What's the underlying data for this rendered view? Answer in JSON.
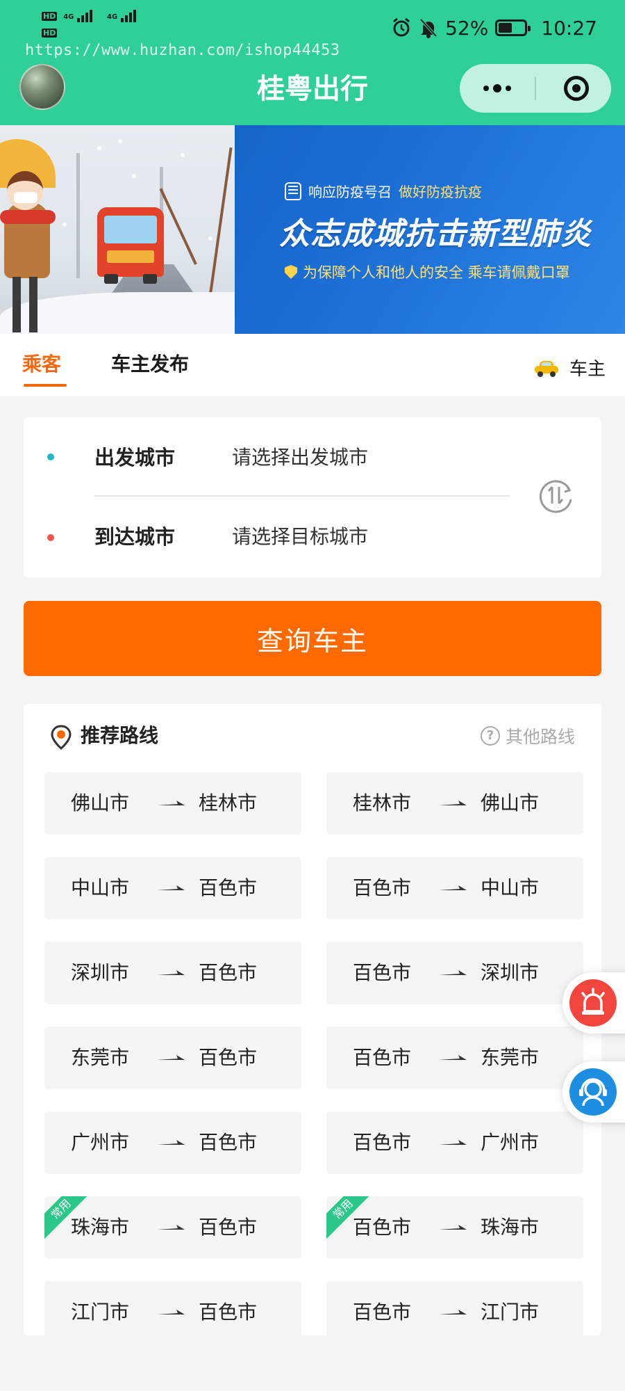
{
  "status_bar": {
    "signal_1": "4G",
    "signal_2": "4G",
    "hd_1": "HD",
    "hd_2": "HD",
    "battery": "52%",
    "battery_level": 0.52,
    "time": "10:27"
  },
  "watermark": "https://www.huzhan.com/ishop44453",
  "header": {
    "title": "桂粤出行"
  },
  "banner": {
    "line1_a": "响应防疫号召",
    "line1_b": "做好防疫抗疫",
    "line2": "众志成城抗击新型肺炎",
    "line3": "为保障个人和他人的安全 乘车请佩戴口罩"
  },
  "tabs": {
    "passenger": "乘客",
    "publish": "车主发布",
    "owner": "车主"
  },
  "city_form": {
    "depart_label": "出发城市",
    "depart_placeholder": "请选择出发城市",
    "arrive_label": "到达城市",
    "arrive_placeholder": "请选择目标城市"
  },
  "search_button": "查询车主",
  "routes": {
    "title": "推荐路线",
    "other": "其他路线",
    "tag_common": "常用",
    "items": [
      {
        "from": "佛山市",
        "to": "桂林市",
        "tag": ""
      },
      {
        "from": "桂林市",
        "to": "佛山市",
        "tag": ""
      },
      {
        "from": "中山市",
        "to": "百色市",
        "tag": ""
      },
      {
        "from": "百色市",
        "to": "中山市",
        "tag": ""
      },
      {
        "from": "深圳市",
        "to": "百色市",
        "tag": ""
      },
      {
        "from": "百色市",
        "to": "深圳市",
        "tag": ""
      },
      {
        "from": "东莞市",
        "to": "百色市",
        "tag": ""
      },
      {
        "from": "百色市",
        "to": "东莞市",
        "tag": ""
      },
      {
        "from": "广州市",
        "to": "百色市",
        "tag": ""
      },
      {
        "from": "百色市",
        "to": "广州市",
        "tag": ""
      },
      {
        "from": "珠海市",
        "to": "百色市",
        "tag": "常用"
      },
      {
        "from": "百色市",
        "to": "珠海市",
        "tag": "常用"
      },
      {
        "from": "江门市",
        "to": "百色市",
        "tag": ""
      },
      {
        "from": "百色市",
        "to": "江门市",
        "tag": ""
      }
    ]
  },
  "colors": {
    "header_bg": "#2fcf98",
    "accent_orange": "#ff6a00",
    "tab_active": "#f06a10",
    "depart_dot": "#1fb7c7",
    "arrive_dot": "#f2544a"
  }
}
